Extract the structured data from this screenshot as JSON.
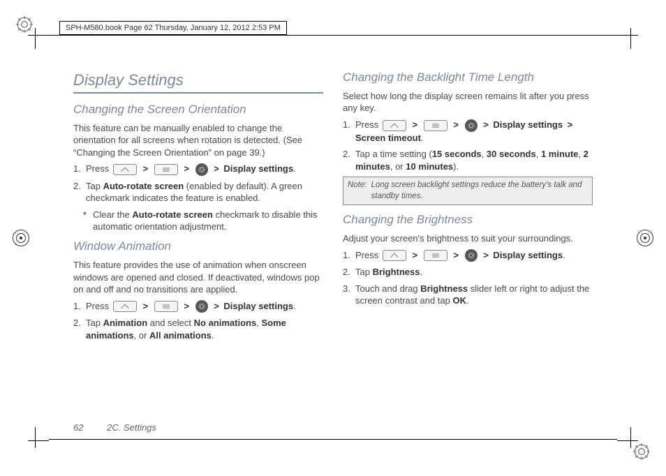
{
  "meta": {
    "header": "SPH-M580.book  Page 62  Thursday, January 12, 2012  2:53 PM"
  },
  "left": {
    "title": "Display Settings",
    "s1": {
      "heading": "Changing the Screen Orientation",
      "intro": "This feature can be manually enabled to change the orientation for all screens when rotation is detected. (See “Changing the Screen Orientation” on page 39.)",
      "step1_prefix": "Press",
      "step1_suffix": "Display settings",
      "step2a": "Tap ",
      "step2b": "Auto-rotate screen",
      "step2c": " (enabled by default). A green checkmark indicates the feature is enabled.",
      "bullet_a": "Clear the ",
      "bullet_b": "Auto-rotate screen",
      "bullet_c": " checkmark to disable this automatic orientation adjustment."
    },
    "s2": {
      "heading": "Window Animation",
      "intro": "This feature provides the use of animation when onscreen windows are opened and closed. If deactivated, windows pop on and off and no transitions are applied.",
      "step1_prefix": "Press",
      "step1_suffix": "Display settings",
      "step2a": "Tap ",
      "step2b": "Animation",
      "step2c": " and select ",
      "step2d": "No animations",
      "step2e": ", ",
      "step2f": "Some animations",
      "step2g": ", or ",
      "step2h": "All animations",
      "step2i": "."
    }
  },
  "right": {
    "s1": {
      "heading": "Changing the Backlight Time Length",
      "intro": "Select how long the display screen remains lit after you press any key.",
      "step1_prefix": "Press",
      "step1_mid": "Display settings",
      "step1_suffix": "Screen timeout",
      "step2a": "Tap a time setting (",
      "step2b": "15 seconds",
      "step2c": ", ",
      "step2d": "30 seconds",
      "step2e": ", ",
      "step2f": "1 minute",
      "step2g": ", ",
      "step2h": "2 minutes",
      "step2i": ", or ",
      "step2j": "10 minutes",
      "step2k": ").",
      "note_label": "Note:",
      "note_text": "Long screen backlight settings reduce the battery's talk and standby times."
    },
    "s2": {
      "heading": "Changing the Brightness",
      "intro": "Adjust your screen's brightness to suit your surroundings.",
      "step1_prefix": "Press",
      "step1_suffix": "Display settings",
      "step2a": "Tap ",
      "step2b": "Brightness",
      "step2c": ".",
      "step3a": "Touch and drag ",
      "step3b": "Brightness",
      "step3c": " slider left or right to adjust the screen contrast and tap ",
      "step3d": "OK",
      "step3e": "."
    }
  },
  "footer": {
    "page": "62",
    "chapter": "2C. Settings"
  },
  "nums": {
    "n1": "1.",
    "n2": "2.",
    "n3": "3."
  },
  "sep": {
    "gt": ">",
    "period": "."
  }
}
